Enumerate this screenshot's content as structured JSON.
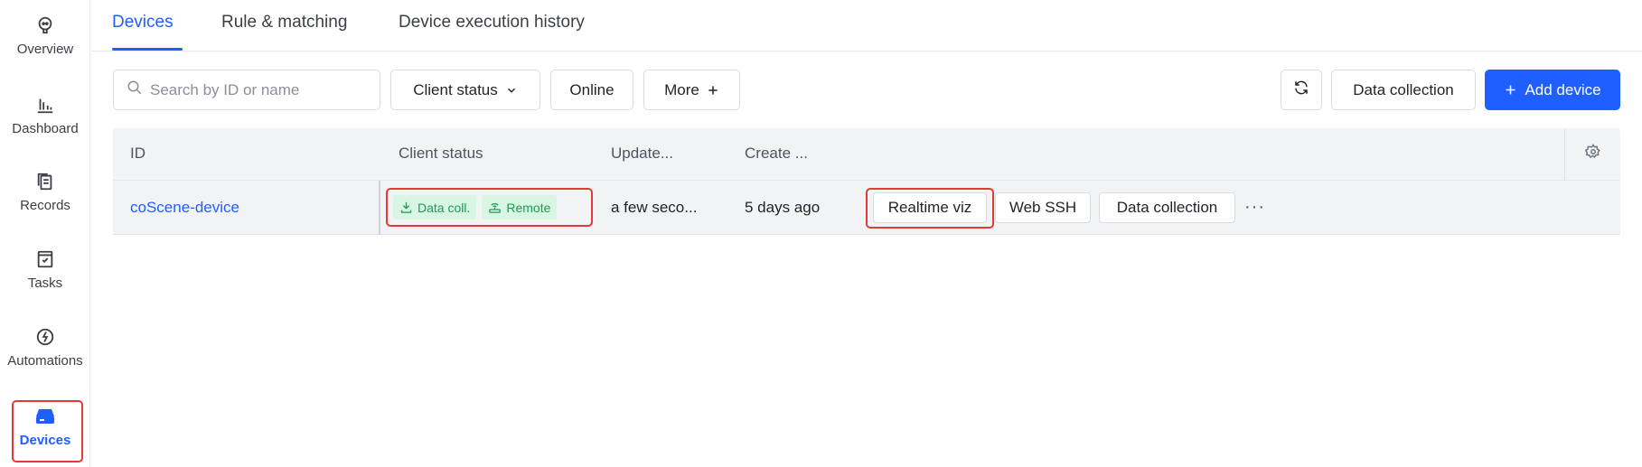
{
  "sidebar": {
    "items": [
      {
        "label": "Overview",
        "icon": "overview-icon"
      },
      {
        "label": "Dashboard",
        "icon": "dashboard-icon"
      },
      {
        "label": "Records",
        "icon": "records-icon"
      },
      {
        "label": "Tasks",
        "icon": "tasks-icon"
      },
      {
        "label": "Automations",
        "icon": "automations-icon"
      },
      {
        "label": "Devices",
        "icon": "devices-icon",
        "active": true
      }
    ]
  },
  "tabs": [
    {
      "label": "Devices",
      "active": true
    },
    {
      "label": "Rule & matching"
    },
    {
      "label": "Device execution history"
    }
  ],
  "toolbar": {
    "search_placeholder": "Search by ID or name",
    "client_status_label": "Client status",
    "online_label": "Online",
    "more_label": "More",
    "data_collection_label": "Data collection",
    "add_device_label": "Add device"
  },
  "table": {
    "columns": [
      "ID",
      "Client status",
      "Update...",
      "Create ..."
    ],
    "rows": [
      {
        "id": "coScene-device",
        "badges": [
          "Data coll.",
          "Remote"
        ],
        "updated": "a few seco...",
        "created": "5 days ago",
        "actions": [
          "Realtime viz",
          "Web SSH",
          "Data collection"
        ],
        "more": "···"
      }
    ]
  },
  "colors": {
    "accent": "#1f5fff",
    "highlight": "#e53935",
    "badge_bg": "#d9f5e4",
    "badge_text": "#1d9a55"
  }
}
